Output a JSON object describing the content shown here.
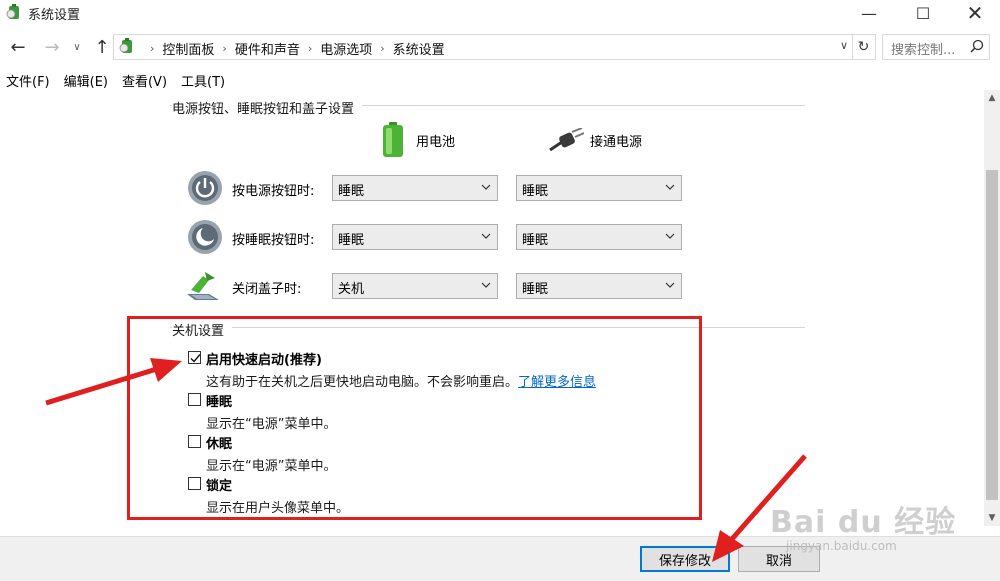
{
  "window": {
    "title": "系统设置",
    "minimize_glyph": "—",
    "maximize_glyph": "☐",
    "close_glyph": "✕"
  },
  "nav": {
    "back_glyph": "←",
    "forward_glyph": "→",
    "recent_glyph": "∨",
    "up_glyph": "↑",
    "breadcrumbs": [
      "控制面板",
      "硬件和声音",
      "电源选项",
      "系统设置"
    ],
    "breadcrumb_separator": "›",
    "refresh_glyph": "↻",
    "search_placeholder": "搜索控制..."
  },
  "menu": [
    "文件(F)",
    "编辑(E)",
    "查看(V)",
    "工具(T)"
  ],
  "power_section": {
    "heading": "电源按钮、睡眠按钮和盖子设置",
    "col_battery": "用电池",
    "col_plugged": "接通电源",
    "rows": [
      {
        "label": "按电源按钮时:",
        "battery": "睡眠",
        "plugged": "睡眠",
        "icon": "power-button-icon"
      },
      {
        "label": "按睡眠按钮时:",
        "battery": "睡眠",
        "plugged": "睡眠",
        "icon": "sleep-button-icon"
      },
      {
        "label": "关闭盖子时:",
        "battery": "关机",
        "plugged": "睡眠",
        "icon": "laptop-lid-icon"
      }
    ]
  },
  "shutdown_section": {
    "heading": "关机设置",
    "options": [
      {
        "title": "启用快速启动(推荐)",
        "desc": "这有助于在关机之后更快地启动电脑。不会影响重启。",
        "link": "了解更多信息",
        "checked": true
      },
      {
        "title": "睡眠",
        "desc": "显示在“电源”菜单中。",
        "checked": false
      },
      {
        "title": "休眠",
        "desc": "显示在“电源”菜单中。",
        "checked": false
      },
      {
        "title": "锁定",
        "desc": "显示在用户头像菜单中。",
        "checked": false
      }
    ]
  },
  "footer": {
    "save_label": "保存修改",
    "cancel_label": "取消"
  },
  "watermark": {
    "brand": "Bai du 经验",
    "url": "jingyan.baidu.com"
  },
  "colors": {
    "annotation_red": "#e0201e",
    "link_blue": "#0066cc",
    "focus_blue": "#0078d7"
  }
}
